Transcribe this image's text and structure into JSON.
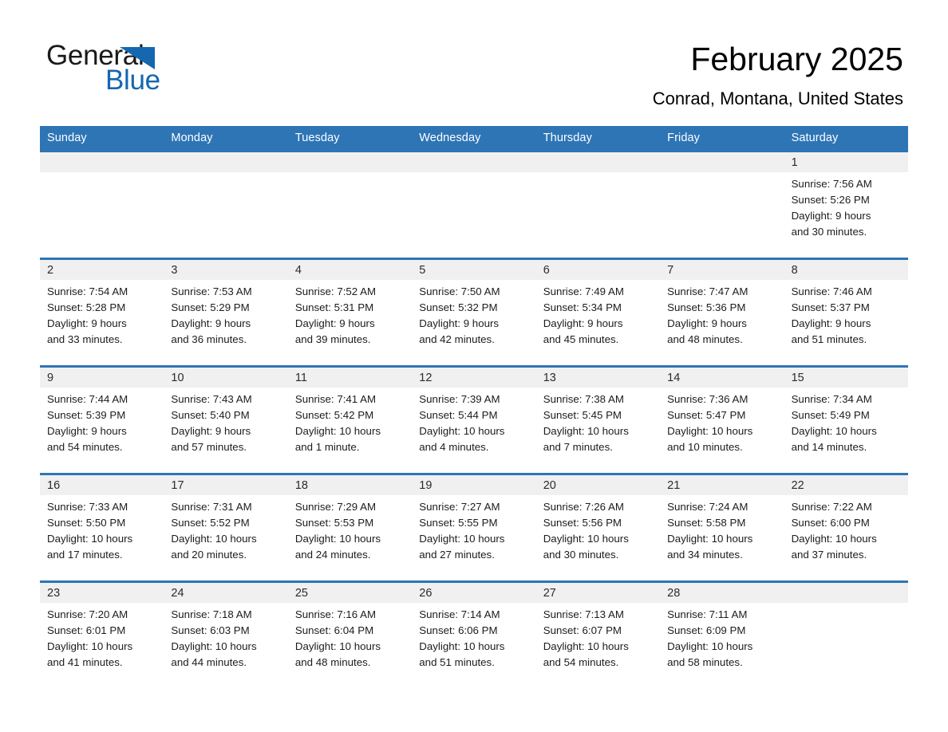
{
  "logo": {
    "word_one": "General",
    "word_two": "Blue",
    "triangle_icon": "triangle-icon",
    "accent_color": "#1567b0"
  },
  "header": {
    "title": "February 2025",
    "subtitle": "Conrad, Montana, United States"
  },
  "theme": {
    "header_bar_color": "#2e75b6",
    "day_band_color": "#f0f0f0",
    "text_color": "#1c1c1c"
  },
  "calendar": {
    "weekdays": [
      "Sunday",
      "Monday",
      "Tuesday",
      "Wednesday",
      "Thursday",
      "Friday",
      "Saturday"
    ],
    "weeks": [
      [
        {
          "day": "",
          "lines": []
        },
        {
          "day": "",
          "lines": []
        },
        {
          "day": "",
          "lines": []
        },
        {
          "day": "",
          "lines": []
        },
        {
          "day": "",
          "lines": []
        },
        {
          "day": "",
          "lines": []
        },
        {
          "day": "1",
          "lines": [
            "Sunrise: 7:56 AM",
            "Sunset: 5:26 PM",
            "Daylight: 9 hours",
            "and 30 minutes."
          ]
        }
      ],
      [
        {
          "day": "2",
          "lines": [
            "Sunrise: 7:54 AM",
            "Sunset: 5:28 PM",
            "Daylight: 9 hours",
            "and 33 minutes."
          ]
        },
        {
          "day": "3",
          "lines": [
            "Sunrise: 7:53 AM",
            "Sunset: 5:29 PM",
            "Daylight: 9 hours",
            "and 36 minutes."
          ]
        },
        {
          "day": "4",
          "lines": [
            "Sunrise: 7:52 AM",
            "Sunset: 5:31 PM",
            "Daylight: 9 hours",
            "and 39 minutes."
          ]
        },
        {
          "day": "5",
          "lines": [
            "Sunrise: 7:50 AM",
            "Sunset: 5:32 PM",
            "Daylight: 9 hours",
            "and 42 minutes."
          ]
        },
        {
          "day": "6",
          "lines": [
            "Sunrise: 7:49 AM",
            "Sunset: 5:34 PM",
            "Daylight: 9 hours",
            "and 45 minutes."
          ]
        },
        {
          "day": "7",
          "lines": [
            "Sunrise: 7:47 AM",
            "Sunset: 5:36 PM",
            "Daylight: 9 hours",
            "and 48 minutes."
          ]
        },
        {
          "day": "8",
          "lines": [
            "Sunrise: 7:46 AM",
            "Sunset: 5:37 PM",
            "Daylight: 9 hours",
            "and 51 minutes."
          ]
        }
      ],
      [
        {
          "day": "9",
          "lines": [
            "Sunrise: 7:44 AM",
            "Sunset: 5:39 PM",
            "Daylight: 9 hours",
            "and 54 minutes."
          ]
        },
        {
          "day": "10",
          "lines": [
            "Sunrise: 7:43 AM",
            "Sunset: 5:40 PM",
            "Daylight: 9 hours",
            "and 57 minutes."
          ]
        },
        {
          "day": "11",
          "lines": [
            "Sunrise: 7:41 AM",
            "Sunset: 5:42 PM",
            "Daylight: 10 hours",
            "and 1 minute."
          ]
        },
        {
          "day": "12",
          "lines": [
            "Sunrise: 7:39 AM",
            "Sunset: 5:44 PM",
            "Daylight: 10 hours",
            "and 4 minutes."
          ]
        },
        {
          "day": "13",
          "lines": [
            "Sunrise: 7:38 AM",
            "Sunset: 5:45 PM",
            "Daylight: 10 hours",
            "and 7 minutes."
          ]
        },
        {
          "day": "14",
          "lines": [
            "Sunrise: 7:36 AM",
            "Sunset: 5:47 PM",
            "Daylight: 10 hours",
            "and 10 minutes."
          ]
        },
        {
          "day": "15",
          "lines": [
            "Sunrise: 7:34 AM",
            "Sunset: 5:49 PM",
            "Daylight: 10 hours",
            "and 14 minutes."
          ]
        }
      ],
      [
        {
          "day": "16",
          "lines": [
            "Sunrise: 7:33 AM",
            "Sunset: 5:50 PM",
            "Daylight: 10 hours",
            "and 17 minutes."
          ]
        },
        {
          "day": "17",
          "lines": [
            "Sunrise: 7:31 AM",
            "Sunset: 5:52 PM",
            "Daylight: 10 hours",
            "and 20 minutes."
          ]
        },
        {
          "day": "18",
          "lines": [
            "Sunrise: 7:29 AM",
            "Sunset: 5:53 PM",
            "Daylight: 10 hours",
            "and 24 minutes."
          ]
        },
        {
          "day": "19",
          "lines": [
            "Sunrise: 7:27 AM",
            "Sunset: 5:55 PM",
            "Daylight: 10 hours",
            "and 27 minutes."
          ]
        },
        {
          "day": "20",
          "lines": [
            "Sunrise: 7:26 AM",
            "Sunset: 5:56 PM",
            "Daylight: 10 hours",
            "and 30 minutes."
          ]
        },
        {
          "day": "21",
          "lines": [
            "Sunrise: 7:24 AM",
            "Sunset: 5:58 PM",
            "Daylight: 10 hours",
            "and 34 minutes."
          ]
        },
        {
          "day": "22",
          "lines": [
            "Sunrise: 7:22 AM",
            "Sunset: 6:00 PM",
            "Daylight: 10 hours",
            "and 37 minutes."
          ]
        }
      ],
      [
        {
          "day": "23",
          "lines": [
            "Sunrise: 7:20 AM",
            "Sunset: 6:01 PM",
            "Daylight: 10 hours",
            "and 41 minutes."
          ]
        },
        {
          "day": "24",
          "lines": [
            "Sunrise: 7:18 AM",
            "Sunset: 6:03 PM",
            "Daylight: 10 hours",
            "and 44 minutes."
          ]
        },
        {
          "day": "25",
          "lines": [
            "Sunrise: 7:16 AM",
            "Sunset: 6:04 PM",
            "Daylight: 10 hours",
            "and 48 minutes."
          ]
        },
        {
          "day": "26",
          "lines": [
            "Sunrise: 7:14 AM",
            "Sunset: 6:06 PM",
            "Daylight: 10 hours",
            "and 51 minutes."
          ]
        },
        {
          "day": "27",
          "lines": [
            "Sunrise: 7:13 AM",
            "Sunset: 6:07 PM",
            "Daylight: 10 hours",
            "and 54 minutes."
          ]
        },
        {
          "day": "28",
          "lines": [
            "Sunrise: 7:11 AM",
            "Sunset: 6:09 PM",
            "Daylight: 10 hours",
            "and 58 minutes."
          ]
        },
        {
          "day": "",
          "lines": []
        }
      ]
    ]
  }
}
